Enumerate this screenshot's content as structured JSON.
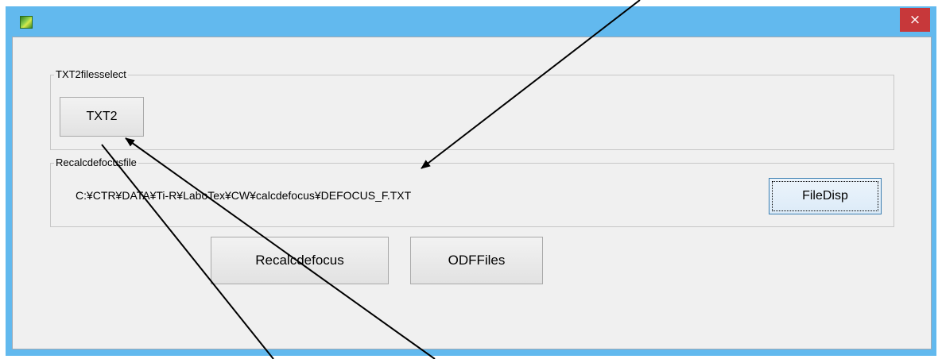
{
  "window": {
    "icon": "app-icon",
    "close_label": "×"
  },
  "txt2_group": {
    "label": "TXT2filesselect",
    "button_label": "TXT2"
  },
  "recalc_group": {
    "label": "Recalcdefocusfile",
    "path": "C:¥CTR¥DATA¥Ti-R¥LaboTex¥CW¥calcdefocus¥DEFOCUS_F.TXT",
    "filedisp_label": "FileDisp"
  },
  "actions": {
    "recalc_label": "Recalcdefocus",
    "odf_label": "ODFFiles"
  },
  "annotations": {
    "arrow_count": 3
  }
}
